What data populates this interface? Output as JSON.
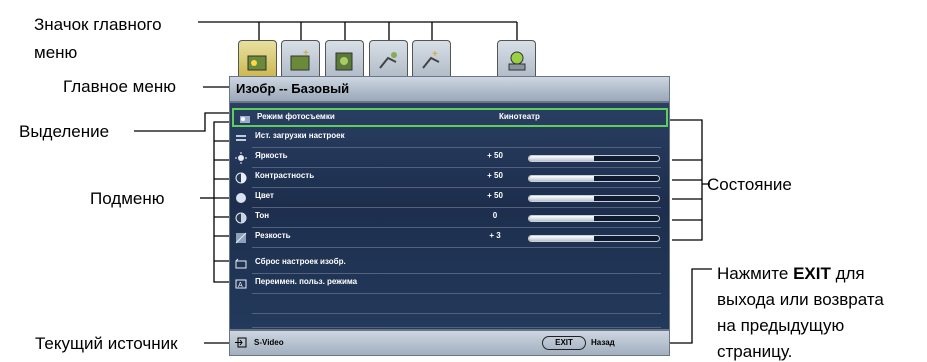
{
  "labels": {
    "main_menu_icon_line1": "Значок главного",
    "main_menu_icon_line2": "меню",
    "main_menu": "Главное меню",
    "highlight": "Выделение",
    "submenu": "Подменю",
    "status": "Состояние",
    "current_source": "Текущий источник",
    "exit_note_pre": "Нажмите ",
    "exit_note_bold": "EXIT",
    "exit_note_post": " для",
    "exit_note_line2": "выхода или возврата",
    "exit_note_line3": "на предыдущую",
    "exit_note_line4": "страницу."
  },
  "osd": {
    "title": "Изобр -- Базовый",
    "tabs": [
      {
        "icon": "picture-tab-icon",
        "active": true
      },
      {
        "icon": "picture-advanced-tab-icon",
        "active": false
      },
      {
        "icon": "audio-tab-icon",
        "active": false
      },
      {
        "icon": "display-tab-icon",
        "active": false
      },
      {
        "icon": "system-setup-tab-icon",
        "active": false
      },
      {
        "icon": "information-tab-icon",
        "active": false
      }
    ],
    "items": [
      {
        "name": "Режим фотосъемки",
        "value": "Кинотеатр",
        "icon": "picture-mode-icon",
        "selected": true
      },
      {
        "name": "Ист. загрузки настроек",
        "value": "",
        "icon": "load-settings-icon"
      },
      {
        "name": "Яркость",
        "value": "+ 50",
        "level": 0.5,
        "icon": "brightness-icon"
      },
      {
        "name": "Контрастность",
        "value": "+ 50",
        "level": 0.5,
        "icon": "contrast-icon"
      },
      {
        "name": "Цвет",
        "value": "+ 50",
        "level": 0.5,
        "icon": "color-icon"
      },
      {
        "name": "Тон",
        "value": "0",
        "level": 0.5,
        "icon": "tint-icon"
      },
      {
        "name": "Резкость",
        "value": "+ 3",
        "level": 0.5,
        "icon": "sharpness-icon"
      },
      {
        "name": "Сброс настроек изобр.",
        "value": "",
        "icon": "reset-picture-icon"
      },
      {
        "name": "Переимен. польз. режима",
        "value": "",
        "icon": "rename-user-mode-icon"
      }
    ],
    "footer": {
      "source": "S-Video",
      "exit": "EXIT",
      "back": "Назад"
    },
    "colors": {
      "body": "#1f3152",
      "highlight": "#5cd05a",
      "bar": "#1a2a45"
    }
  }
}
